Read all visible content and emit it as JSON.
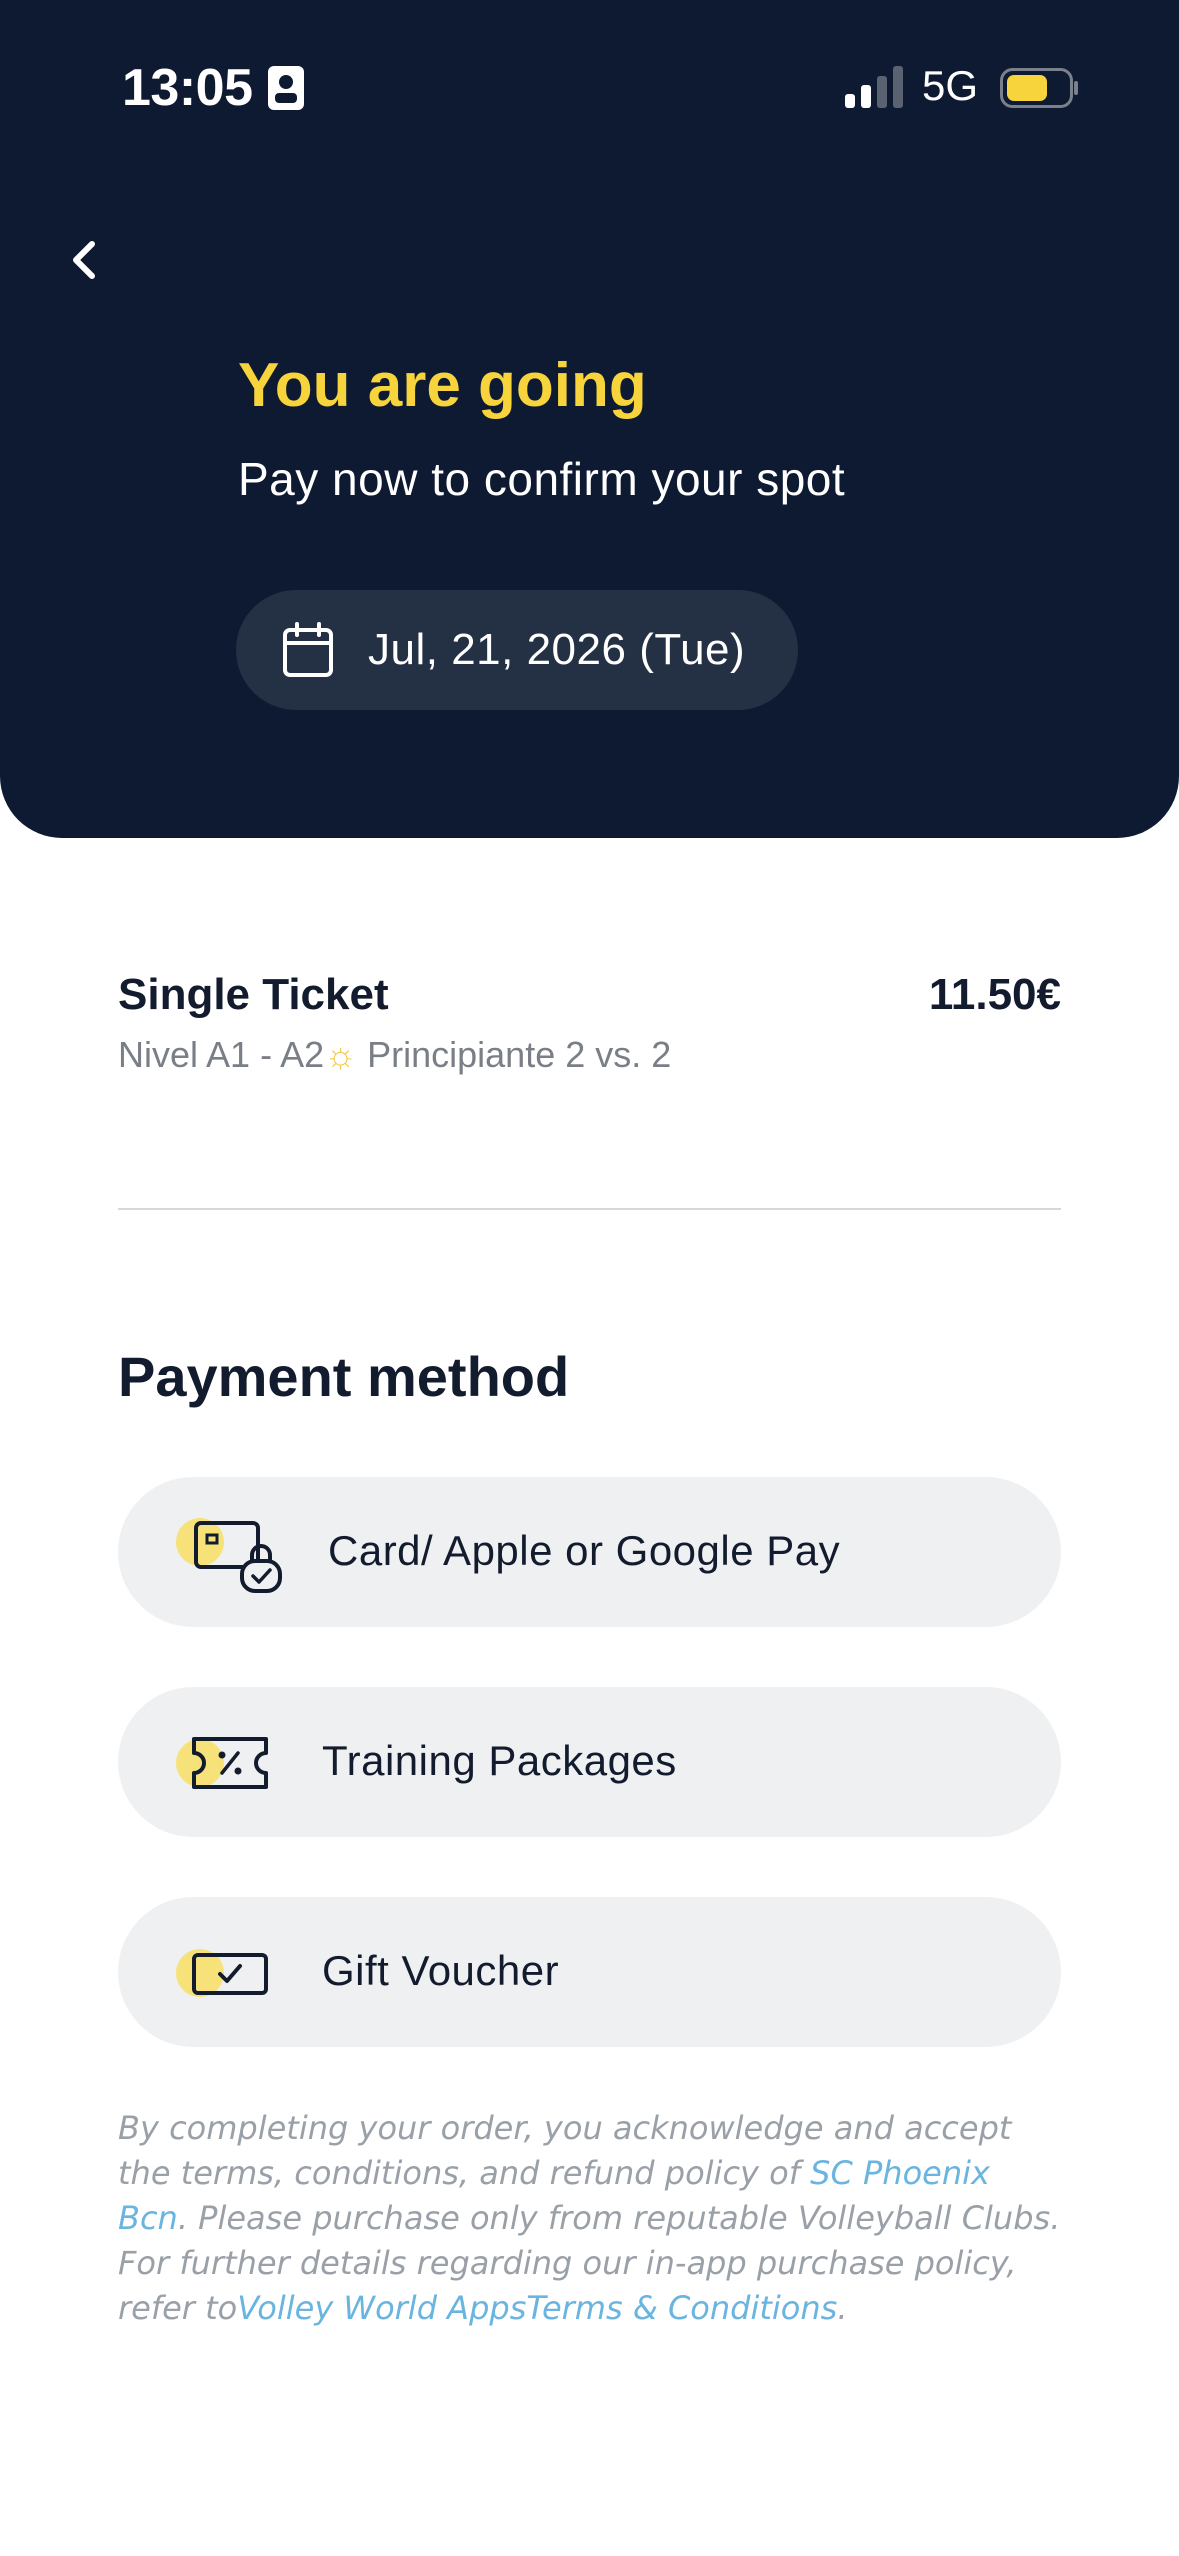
{
  "status_bar": {
    "time": "13:05",
    "network": "5G",
    "battery_color": "#f7d43b"
  },
  "header": {
    "back_icon": "chevron-left-icon",
    "title": "You are going",
    "subtitle": "Pay now to confirm your spot",
    "date_icon": "calendar-icon",
    "date": "Jul, 21, 2026 (Tue)"
  },
  "ticket": {
    "name": "Single Ticket",
    "price": "11.50€",
    "desc_prefix": "Nivel A1 - A2",
    "desc_emoji": "☼",
    "desc_suffix": " Principiante 2 vs. 2"
  },
  "payment": {
    "title": "Payment method",
    "options": [
      {
        "label": "Card/ Apple or Google Pay",
        "icon": "card-lock-icon"
      },
      {
        "label": "Training Packages",
        "icon": "ticket-percent-icon"
      },
      {
        "label": "Gift Voucher",
        "icon": "voucher-check-icon"
      }
    ]
  },
  "legal": {
    "part1": "By completing your order, you acknowledge and accept the terms, conditions, and refund policy of ",
    "club_link": "SC Phoenix Bcn",
    "part2": ". Please purchase only from reputable Volleyball Clubs. For further details regarding our in-app purchase policy, refer to",
    "terms_link": "Volley World AppsTerms & Conditions",
    "part3": "."
  },
  "colors": {
    "header_bg": "#0e1a31",
    "accent_yellow": "#f7d43b",
    "pill_bg": "#243044",
    "option_bg": "#eff0f1",
    "link": "#6ab4e0"
  }
}
